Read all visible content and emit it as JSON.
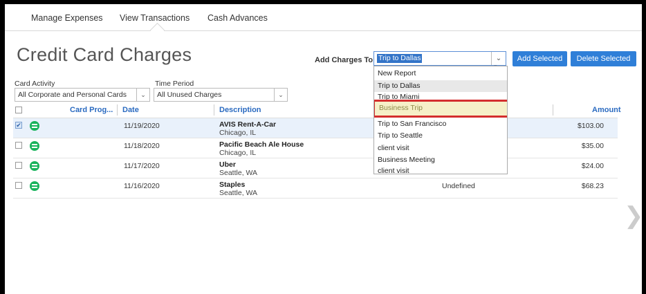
{
  "tabs": [
    {
      "label": "Manage Expenses"
    },
    {
      "label": "View Transactions"
    },
    {
      "label": "Cash Advances"
    }
  ],
  "page_title": "Credit Card Charges",
  "add_charges": {
    "label": "Add Charges To",
    "selected": "Trip to Dallas",
    "options": [
      {
        "label": "New Report"
      },
      {
        "label": "Trip to Dallas"
      },
      {
        "label": "Trip to Miami"
      },
      {
        "label": "Business Trip"
      },
      {
        "label": "Trip to San Francisco"
      },
      {
        "label": "Trip to Seattle"
      },
      {
        "label": "client visit"
      },
      {
        "label": "Business Meeting"
      },
      {
        "label": "client visit"
      }
    ]
  },
  "buttons": {
    "add_selected": "Add Selected",
    "delete_selected": "Delete Selected"
  },
  "filters": {
    "card_activity_label": "Card Activity",
    "card_activity_value": "All Corporate and Personal Cards",
    "time_period_label": "Time Period",
    "time_period_value": "All Unused Charges"
  },
  "columns": {
    "card_program": "Card Prog...",
    "date": "Date",
    "description": "Description",
    "amount": "Amount"
  },
  "rows": [
    {
      "date": "11/19/2020",
      "name": "AVIS Rent-A-Car",
      "location": "Chicago, IL",
      "type": "",
      "amount": "$103.00",
      "checked": true
    },
    {
      "date": "11/18/2020",
      "name": "Pacific Beach Ale House",
      "location": "Chicago, IL",
      "type": "",
      "amount": "$35.00",
      "checked": false
    },
    {
      "date": "11/17/2020",
      "name": "Uber",
      "location": "Seattle, WA",
      "type": "",
      "amount": "$24.00",
      "checked": false
    },
    {
      "date": "11/16/2020",
      "name": "Staples",
      "location": "Seattle, WA",
      "type": "Undefined",
      "amount": "$68.23",
      "checked": false
    }
  ],
  "icons": {
    "dropdown": "chevron-down-icon",
    "expense_type": "list-icon",
    "next_page": "chevron-right-icon",
    "check": "✔"
  },
  "colors": {
    "accent": "#2f7fd8",
    "highlight_border": "#d42e2e",
    "expense_icon": "#19b35c"
  }
}
